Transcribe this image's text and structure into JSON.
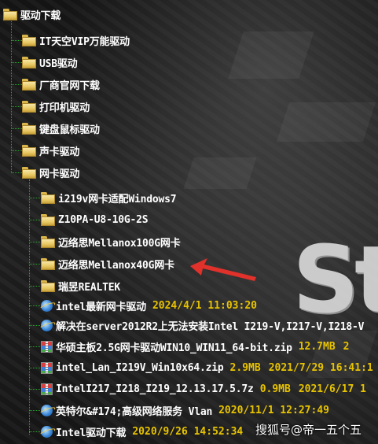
{
  "tree": {
    "root": {
      "label": "驱动下载"
    },
    "folders": [
      {
        "label": "IT天空VIP万能驱动"
      },
      {
        "label": "USB驱动"
      },
      {
        "label": "厂商官网下载"
      },
      {
        "label": "打印机驱动"
      },
      {
        "label": "键盘鼠标驱动"
      },
      {
        "label": "声卡驱动"
      },
      {
        "label": "网卡驱动"
      }
    ],
    "subfolders": [
      {
        "label": "i219v网卡适配Windows7"
      },
      {
        "label": "Z10PA-U8-10G-2S"
      },
      {
        "label": "迈络思Mellanox100G网卡"
      },
      {
        "label": "迈络思Mellanox40G网卡"
      },
      {
        "label": "瑞昱REALTEK"
      }
    ],
    "files": [
      {
        "icon": "ie-icon",
        "name": "intel最新网卡驱动",
        "size": "",
        "date": "2024/4/1 11:03:20"
      },
      {
        "icon": "ie-icon",
        "name": "解决在server2012R2上无法安装Intel I219-V,I217-V,I218-V",
        "size": "",
        "date": ""
      },
      {
        "icon": "zip-icon",
        "name": "华硕主板2.5G网卡驱动WIN10_WIN11_64-bit.zip",
        "size": "12.7MB",
        "date": "2"
      },
      {
        "icon": "zip-icon",
        "name": "intel_Lan_I219V_Win10x64.zip",
        "size": "2.9MB",
        "date": "2021/7/29 16:41:1"
      },
      {
        "icon": "zip-icon",
        "name": "IntelI217_I218_I219_12.13.17.5.7z",
        "size": "0.9MB",
        "date": "2021/6/17 1"
      },
      {
        "icon": "ie-icon",
        "name": "英特尔&#174;高级网络服务 Vlan",
        "size": "",
        "date": "2020/11/1 12:27:49"
      },
      {
        "icon": "ie-icon",
        "name": "Intel驱动下载",
        "size": "",
        "date": "2020/9/26 14:52:34"
      }
    ]
  },
  "background": {
    "logo_text": "St"
  },
  "watermark": {
    "text": "搜狐号@帝一五个五"
  },
  "colors": {
    "tree_line": "#27a827",
    "meta_text": "#e7c300",
    "arrow": "#e0312b"
  }
}
